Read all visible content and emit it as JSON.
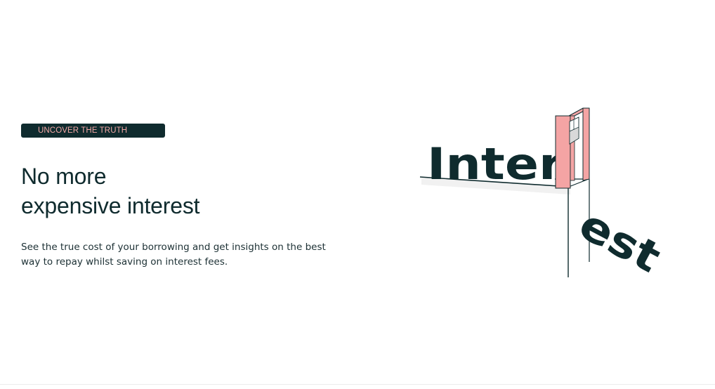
{
  "hero": {
    "badge": "UNCOVER THE TRUTH",
    "headline_line1": "No more",
    "headline_line2": "expensive interest",
    "description_line1": "See the true cost of your borrowing and get insights on the best",
    "description_line2": "way to repay whilst saving on interest fees."
  },
  "illustration": {
    "word_part1": "Inter",
    "word_part2": "est",
    "icon": "guillotine-icon"
  },
  "colors": {
    "dark": "#0f2b2e",
    "accent_pink": "#f2a7a5",
    "text": "#1c3034",
    "background": "#ffffff"
  }
}
